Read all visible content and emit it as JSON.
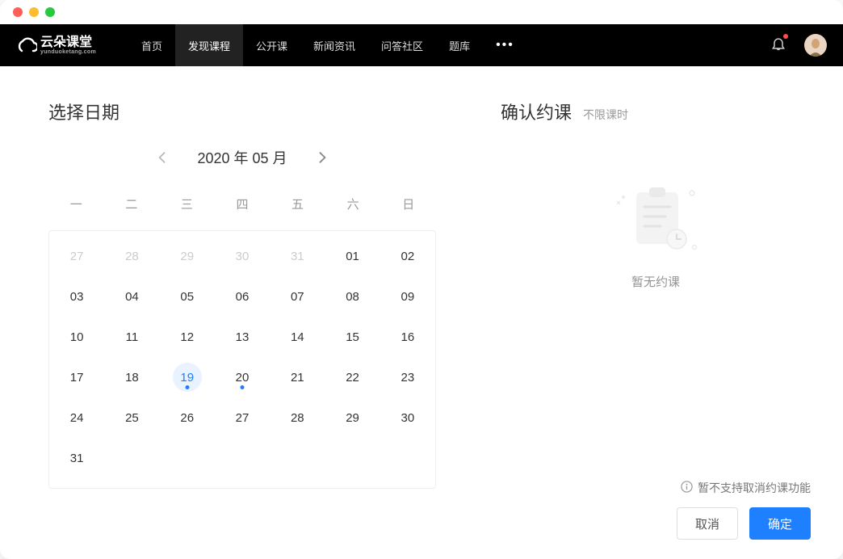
{
  "logo": {
    "text_a": "云朵课堂",
    "text_b": "yunduoketang.com"
  },
  "nav": {
    "items": [
      "首页",
      "发现课程",
      "公开课",
      "新闻资讯",
      "问答社区",
      "题库"
    ],
    "active_index": 1
  },
  "date_panel": {
    "title": "选择日期",
    "month_label": "2020 年 05 月",
    "weekdays": [
      "一",
      "二",
      "三",
      "四",
      "五",
      "六",
      "日"
    ],
    "days": [
      {
        "n": "27",
        "other": true
      },
      {
        "n": "28",
        "other": true
      },
      {
        "n": "29",
        "other": true
      },
      {
        "n": "30",
        "other": true
      },
      {
        "n": "31",
        "other": true
      },
      {
        "n": "01"
      },
      {
        "n": "02"
      },
      {
        "n": "03"
      },
      {
        "n": "04"
      },
      {
        "n": "05"
      },
      {
        "n": "06"
      },
      {
        "n": "07"
      },
      {
        "n": "08"
      },
      {
        "n": "09"
      },
      {
        "n": "10"
      },
      {
        "n": "11"
      },
      {
        "n": "12"
      },
      {
        "n": "13"
      },
      {
        "n": "14"
      },
      {
        "n": "15"
      },
      {
        "n": "16"
      },
      {
        "n": "17"
      },
      {
        "n": "18"
      },
      {
        "n": "19",
        "today": true,
        "dot": true
      },
      {
        "n": "20",
        "dot": true
      },
      {
        "n": "21"
      },
      {
        "n": "22"
      },
      {
        "n": "23"
      },
      {
        "n": "24"
      },
      {
        "n": "25"
      },
      {
        "n": "26"
      },
      {
        "n": "27"
      },
      {
        "n": "28"
      },
      {
        "n": "29"
      },
      {
        "n": "30"
      },
      {
        "n": "31"
      }
    ]
  },
  "confirm_panel": {
    "title": "确认约课",
    "subtitle": "不限课时",
    "empty_text": "暂无约课",
    "warning_text": "暂不支持取消约课功能",
    "cancel_label": "取消",
    "confirm_label": "确定"
  },
  "colors": {
    "accent": "#1e80ff",
    "accent_bg": "#e8f3ff"
  }
}
